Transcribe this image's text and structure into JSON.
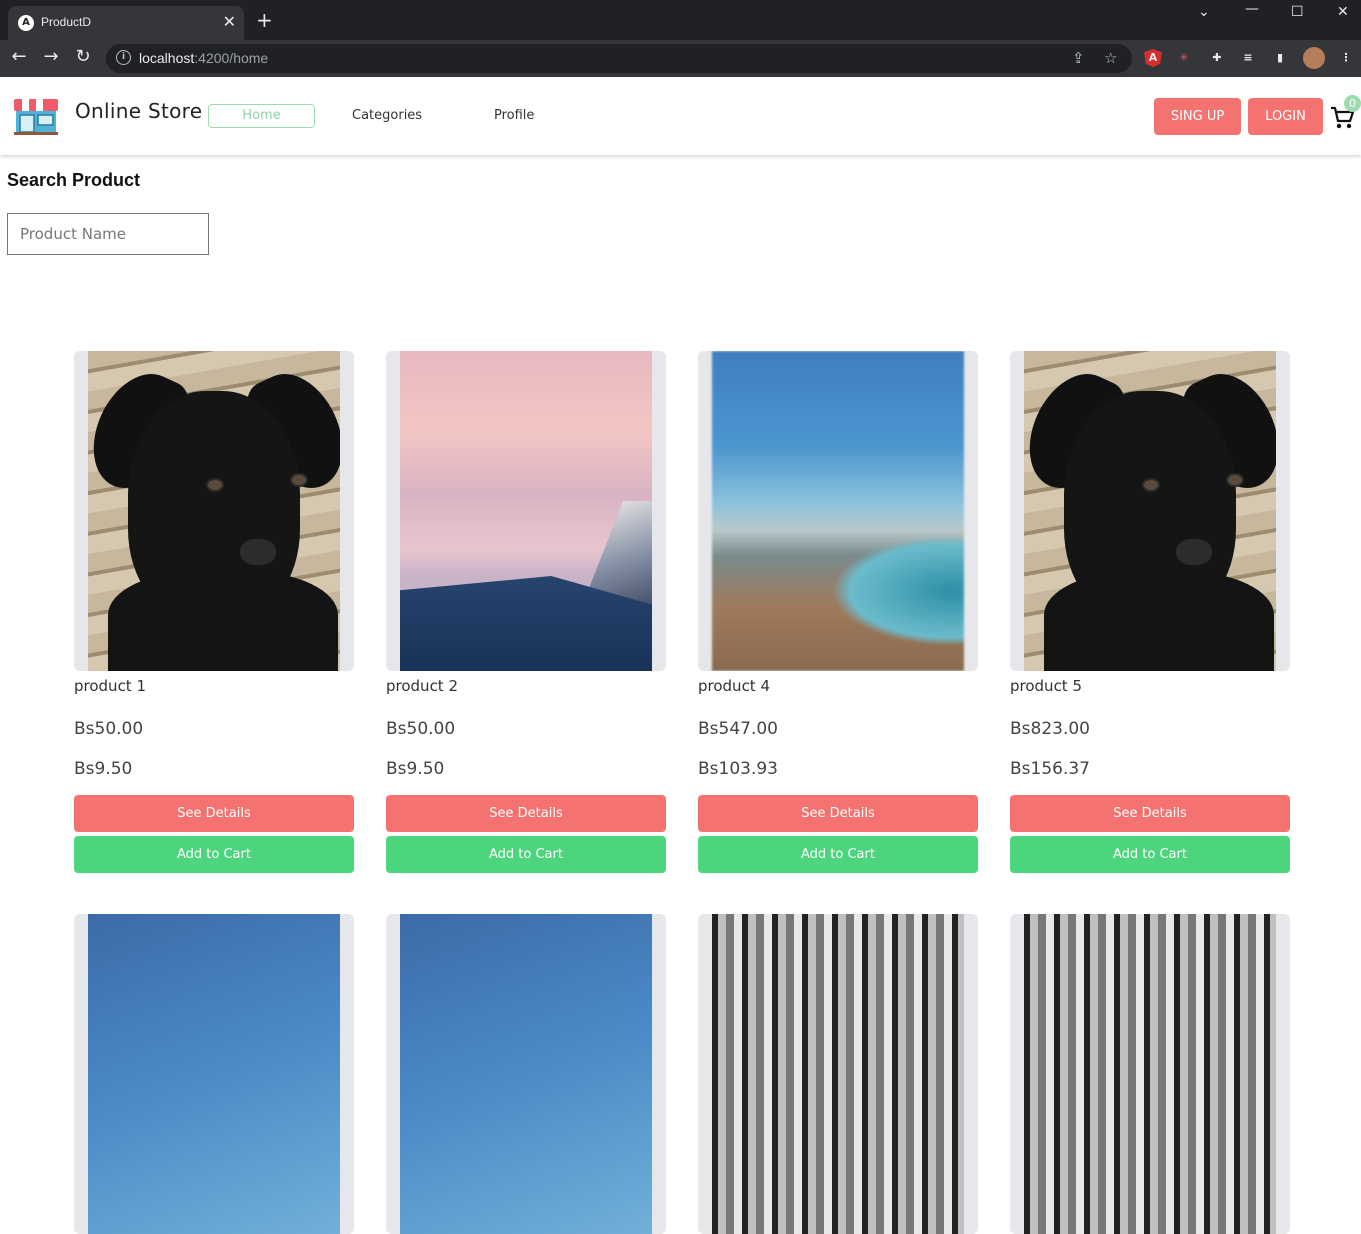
{
  "browser": {
    "tab_title": "ProductD",
    "tab_favicon": "A",
    "url_host": "localhost",
    "url_rest": ":4200/home",
    "badge_count": "0"
  },
  "header": {
    "brand": "Online Store",
    "nav": [
      "Home",
      "Categories",
      "Profile"
    ],
    "signup_label": "SING UP",
    "login_label": "LOGIN",
    "cart_count": "0"
  },
  "search": {
    "title": "Search Product",
    "placeholder": "Product Name"
  },
  "products": [
    {
      "name": "product 1",
      "price": "Bs50.00",
      "price2": "Bs9.50",
      "image": "black-puppy",
      "details_label": "See Details",
      "cart_label": "Add to Cart"
    },
    {
      "name": "product 2",
      "price": "Bs50.00",
      "price2": "Bs9.50",
      "image": "snowy-mountain-sunset",
      "details_label": "See Details",
      "cart_label": "Add to Cart"
    },
    {
      "name": "product 4",
      "price": "Bs547.00",
      "price2": "Bs103.93",
      "image": "blurred-beach",
      "details_label": "See Details",
      "cart_label": "Add to Cart"
    },
    {
      "name": "product 5",
      "price": "Bs823.00",
      "price2": "Bs156.37",
      "image": "black-puppy",
      "details_label": "See Details",
      "cart_label": "Add to Cart"
    }
  ],
  "products_row2": [
    {
      "image": "blue-gradient"
    },
    {
      "image": "blue-gradient"
    },
    {
      "image": "street-bw"
    },
    {
      "image": "street-bw"
    }
  ],
  "colors": {
    "danger": "#f47270",
    "success": "#4cd57d",
    "accent": "#9ddcb0"
  }
}
